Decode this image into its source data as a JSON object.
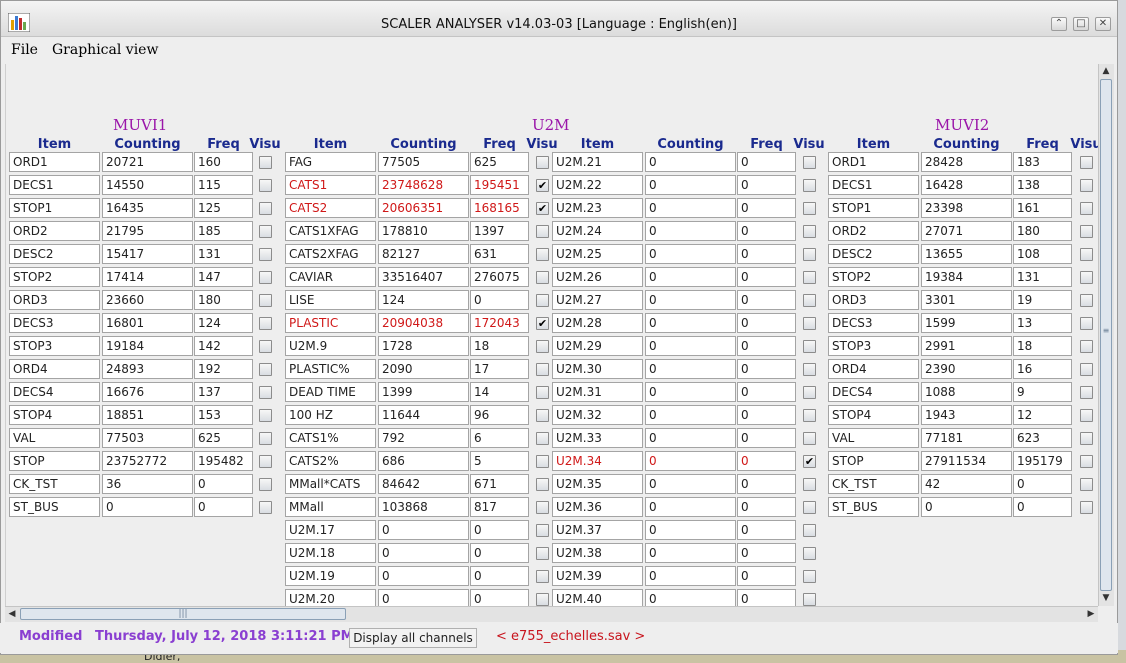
{
  "window": {
    "title": "SCALER ANALYSER v14.03-03 [Language : English(en)]",
    "controls": [
      "⌃",
      "□",
      "✕"
    ]
  },
  "menubar": {
    "file": "File",
    "graphical": "Graphical view"
  },
  "headers": {
    "item": "Item",
    "counting": "Counting",
    "freq": "Freq",
    "visu": "Visu"
  },
  "groups": [
    {
      "title": "MUVI1",
      "rows": [
        {
          "item": "ORD1",
          "counting": "20721",
          "freq": "160",
          "checked": false
        },
        {
          "item": "DECS1",
          "counting": "14550",
          "freq": "115",
          "checked": false
        },
        {
          "item": "STOP1",
          "counting": "16435",
          "freq": "125",
          "checked": false
        },
        {
          "item": "ORD2",
          "counting": "21795",
          "freq": "185",
          "checked": false
        },
        {
          "item": "DESC2",
          "counting": "15417",
          "freq": "131",
          "checked": false
        },
        {
          "item": "STOP2",
          "counting": "17414",
          "freq": "147",
          "checked": false
        },
        {
          "item": "ORD3",
          "counting": "23660",
          "freq": "180",
          "checked": false
        },
        {
          "item": "DECS3",
          "counting": "16801",
          "freq": "124",
          "checked": false
        },
        {
          "item": "STOP3",
          "counting": "19184",
          "freq": "142",
          "checked": false
        },
        {
          "item": "ORD4",
          "counting": "24893",
          "freq": "192",
          "checked": false
        },
        {
          "item": "DECS4",
          "counting": "16676",
          "freq": "137",
          "checked": false
        },
        {
          "item": "STOP4",
          "counting": "18851",
          "freq": "153",
          "checked": false
        },
        {
          "item": "VAL",
          "counting": "77503",
          "freq": "625",
          "checked": false
        },
        {
          "item": "STOP",
          "counting": "23752772",
          "freq": "195482",
          "checked": false
        },
        {
          "item": "CK_TST",
          "counting": "36",
          "freq": "0",
          "checked": false
        },
        {
          "item": "ST_BUS",
          "counting": "0",
          "freq": "0",
          "checked": false
        }
      ]
    },
    {
      "title": "U2M",
      "rows": [
        {
          "item": "FAG",
          "counting": "77505",
          "freq": "625",
          "checked": false
        },
        {
          "item": "CATS1",
          "counting": "23748628",
          "freq": "195451",
          "checked": true
        },
        {
          "item": "CATS2",
          "counting": "20606351",
          "freq": "168165",
          "checked": true
        },
        {
          "item": "CATS1XFAG",
          "counting": "178810",
          "freq": "1397",
          "checked": false
        },
        {
          "item": "CATS2XFAG",
          "counting": "82127",
          "freq": "631",
          "checked": false
        },
        {
          "item": "CAVIAR",
          "counting": "33516407",
          "freq": "276075",
          "checked": false
        },
        {
          "item": "LISE",
          "counting": "124",
          "freq": "0",
          "checked": false
        },
        {
          "item": "PLASTIC",
          "counting": "20904038",
          "freq": "172043",
          "checked": true
        },
        {
          "item": "U2M.9",
          "counting": "1728",
          "freq": "18",
          "checked": false
        },
        {
          "item": "PLASTIC%",
          "counting": "2090",
          "freq": "17",
          "checked": false
        },
        {
          "item": "DEAD TIME",
          "counting": "1399",
          "freq": "14",
          "checked": false
        },
        {
          "item": "100 HZ",
          "counting": "11644",
          "freq": "96",
          "checked": false
        },
        {
          "item": "CATS1%",
          "counting": "792",
          "freq": "6",
          "checked": false
        },
        {
          "item": "CATS2%",
          "counting": "686",
          "freq": "5",
          "checked": false
        },
        {
          "item": "MMall*CATS",
          "counting": "84642",
          "freq": "671",
          "checked": false
        },
        {
          "item": "MMall",
          "counting": "103868",
          "freq": "817",
          "checked": false
        },
        {
          "item": "U2M.17",
          "counting": "0",
          "freq": "0",
          "checked": false
        },
        {
          "item": "U2M.18",
          "counting": "0",
          "freq": "0",
          "checked": false
        },
        {
          "item": "U2M.19",
          "counting": "0",
          "freq": "0",
          "checked": false
        },
        {
          "item": "U2M.20",
          "counting": "0",
          "freq": "0",
          "checked": false
        }
      ]
    },
    {
      "title": "",
      "rows": [
        {
          "item": "U2M.21",
          "counting": "0",
          "freq": "0",
          "checked": false
        },
        {
          "item": "U2M.22",
          "counting": "0",
          "freq": "0",
          "checked": false
        },
        {
          "item": "U2M.23",
          "counting": "0",
          "freq": "0",
          "checked": false
        },
        {
          "item": "U2M.24",
          "counting": "0",
          "freq": "0",
          "checked": false
        },
        {
          "item": "U2M.25",
          "counting": "0",
          "freq": "0",
          "checked": false
        },
        {
          "item": "U2M.26",
          "counting": "0",
          "freq": "0",
          "checked": false
        },
        {
          "item": "U2M.27",
          "counting": "0",
          "freq": "0",
          "checked": false
        },
        {
          "item": "U2M.28",
          "counting": "0",
          "freq": "0",
          "checked": false
        },
        {
          "item": "U2M.29",
          "counting": "0",
          "freq": "0",
          "checked": false
        },
        {
          "item": "U2M.30",
          "counting": "0",
          "freq": "0",
          "checked": false
        },
        {
          "item": "U2M.31",
          "counting": "0",
          "freq": "0",
          "checked": false
        },
        {
          "item": "U2M.32",
          "counting": "0",
          "freq": "0",
          "checked": false
        },
        {
          "item": "U2M.33",
          "counting": "0",
          "freq": "0",
          "checked": false
        },
        {
          "item": "U2M.34",
          "counting": "0",
          "freq": "0",
          "checked": true
        },
        {
          "item": "U2M.35",
          "counting": "0",
          "freq": "0",
          "checked": false
        },
        {
          "item": "U2M.36",
          "counting": "0",
          "freq": "0",
          "checked": false
        },
        {
          "item": "U2M.37",
          "counting": "0",
          "freq": "0",
          "checked": false
        },
        {
          "item": "U2M.38",
          "counting": "0",
          "freq": "0",
          "checked": false
        },
        {
          "item": "U2M.39",
          "counting": "0",
          "freq": "0",
          "checked": false
        },
        {
          "item": "U2M.40",
          "counting": "0",
          "freq": "0",
          "checked": false
        }
      ]
    },
    {
      "title": "MUVI2",
      "rows": [
        {
          "item": "ORD1",
          "counting": "28428",
          "freq": "183",
          "checked": false
        },
        {
          "item": "DECS1",
          "counting": "16428",
          "freq": "138",
          "checked": false
        },
        {
          "item": "STOP1",
          "counting": "23398",
          "freq": "161",
          "checked": false
        },
        {
          "item": "ORD2",
          "counting": "27071",
          "freq": "180",
          "checked": false
        },
        {
          "item": "DESC2",
          "counting": "13655",
          "freq": "108",
          "checked": false
        },
        {
          "item": "STOP2",
          "counting": "19384",
          "freq": "131",
          "checked": false
        },
        {
          "item": "ORD3",
          "counting": "3301",
          "freq": "19",
          "checked": false
        },
        {
          "item": "DECS3",
          "counting": "1599",
          "freq": "13",
          "checked": false
        },
        {
          "item": "STOP3",
          "counting": "2991",
          "freq": "18",
          "checked": false
        },
        {
          "item": "ORD4",
          "counting": "2390",
          "freq": "16",
          "checked": false
        },
        {
          "item": "DECS4",
          "counting": "1088",
          "freq": "9",
          "checked": false
        },
        {
          "item": "STOP4",
          "counting": "1943",
          "freq": "12",
          "checked": false
        },
        {
          "item": "VAL",
          "counting": "77181",
          "freq": "623",
          "checked": false
        },
        {
          "item": "STOP",
          "counting": "27911534",
          "freq": "195179",
          "checked": false
        },
        {
          "item": "CK_TST",
          "counting": "42",
          "freq": "0",
          "checked": false
        },
        {
          "item": "ST_BUS",
          "counting": "0",
          "freq": "0",
          "checked": false
        }
      ]
    }
  ],
  "status": {
    "modified": "Modified",
    "datetime": "Thursday, July 12, 2018 3:11:21 PM",
    "display_all": "Display all channels",
    "file": "< e755_echelles.sav >"
  },
  "background": {
    "desk_label": "Didier,"
  },
  "colors": {
    "accent": "#9a15a9",
    "header": "#1a2a8e",
    "active": "#d01818",
    "status": "#8a3fd1",
    "file": "#c8141d"
  }
}
